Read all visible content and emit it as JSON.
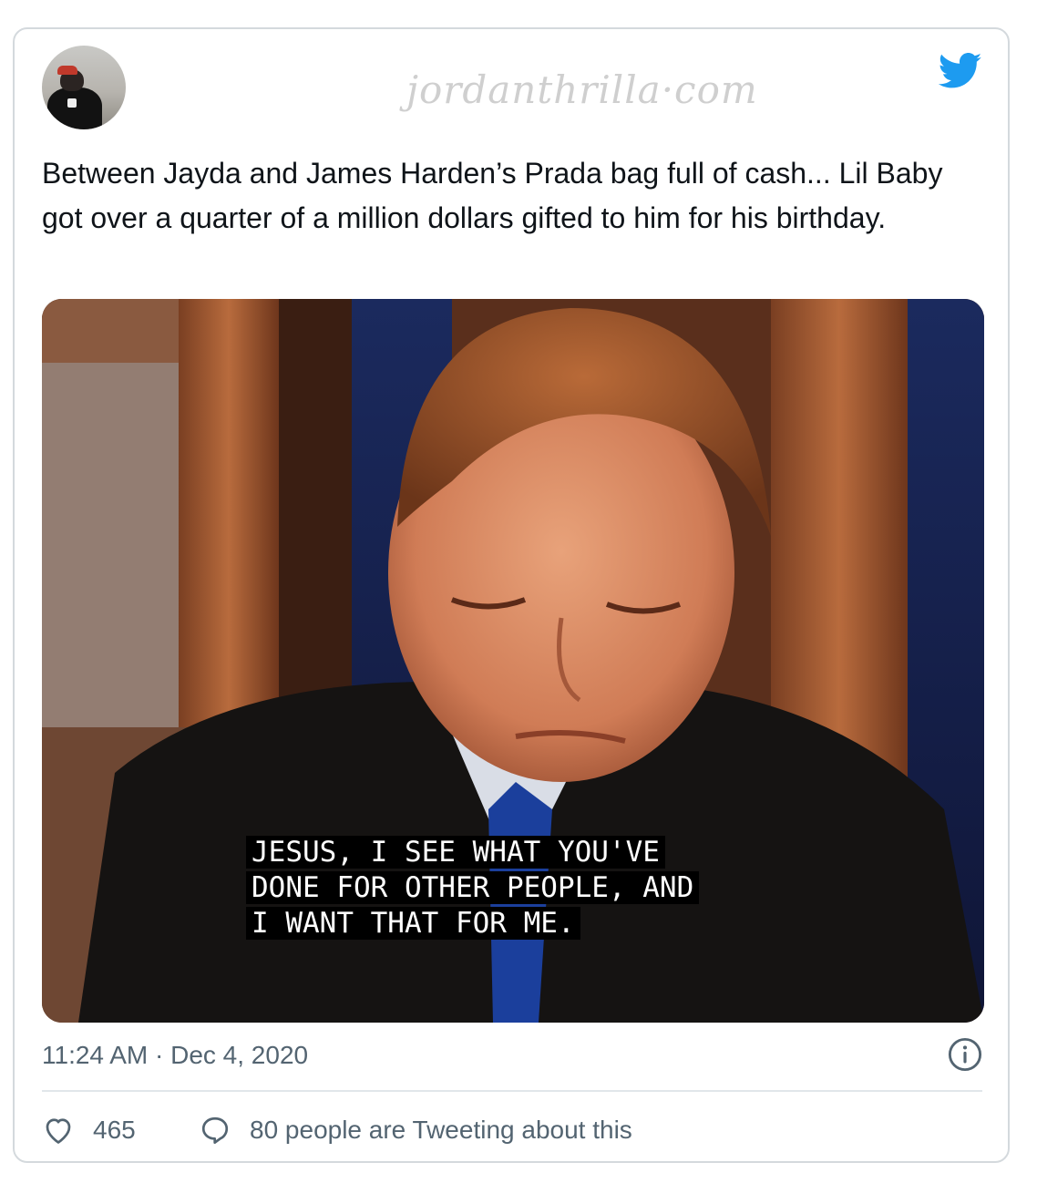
{
  "tweet": {
    "text": "Between Jayda and James Harden’s Prada bag full of cash... Lil Baby got over a quarter of a million dollars gifted to him for his birthday.",
    "timestamp": "11:24 AM · Dec 4, 2020",
    "watermark": "jordanthrilla·com",
    "media_caption": [
      "JESUS, I SEE WHAT YOU'VE",
      "DONE FOR OTHER PEOPLE, AND",
      "I WANT THAT FOR ME."
    ]
  },
  "actions": {
    "likes": "465",
    "tweeting": "80 people are Tweeting about this"
  },
  "icons": {
    "brand": "twitter-bird-icon",
    "info": "info-icon",
    "like": "heart-icon",
    "reply": "speech-bubble-icon"
  },
  "colors": {
    "twitter_blue": "#1d9bf0",
    "secondary_text": "#536471",
    "border": "#d4d9dd"
  }
}
